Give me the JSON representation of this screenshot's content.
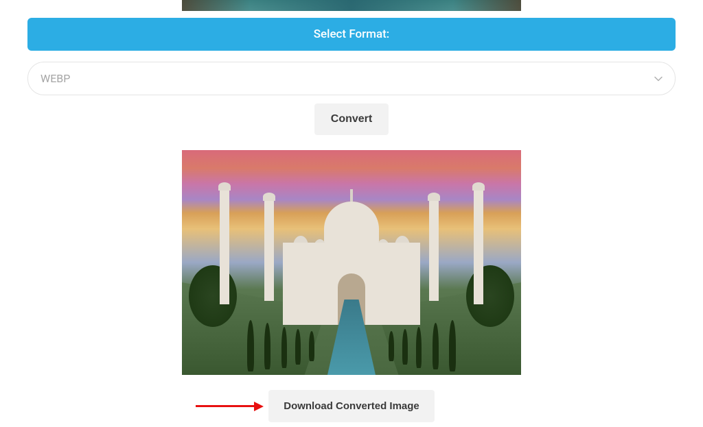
{
  "format_header": "Select Format:",
  "format_select": {
    "selected": "WEBP"
  },
  "buttons": {
    "convert": "Convert",
    "download": "Download Converted Image"
  },
  "colors": {
    "header_bg": "#2cade4",
    "button_bg": "#f2f2f2",
    "arrow": "#e81010"
  },
  "icons": {
    "chevron_down": "chevron-down-icon"
  }
}
